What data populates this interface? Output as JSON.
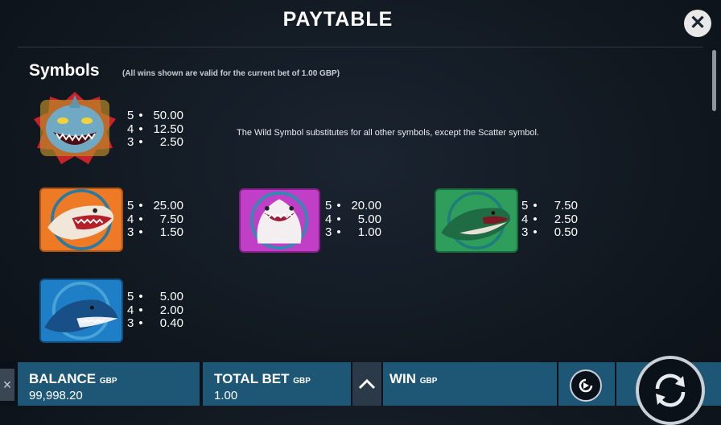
{
  "header": {
    "title": "PAYTABLE",
    "close_icon": "close-icon"
  },
  "symbols": {
    "title": "Symbols",
    "note": "(All wins shown are valid for the current bet of 1.00 GBP)",
    "wild_description": "The Wild Symbol substitutes for all other symbols, except the Scatter symbol.",
    "items": [
      {
        "name": "wild-shark",
        "pays": [
          {
            "count": "5",
            "value": "50.00"
          },
          {
            "count": "4",
            "value": "12.50"
          },
          {
            "count": "3",
            "value": "2.50"
          }
        ]
      },
      {
        "name": "orange-shark",
        "pays": [
          {
            "count": "5",
            "value": "25.00"
          },
          {
            "count": "4",
            "value": "7.50"
          },
          {
            "count": "3",
            "value": "1.50"
          }
        ]
      },
      {
        "name": "pink-shark",
        "pays": [
          {
            "count": "5",
            "value": "20.00"
          },
          {
            "count": "4",
            "value": "5.00"
          },
          {
            "count": "3",
            "value": "1.00"
          }
        ]
      },
      {
        "name": "green-shark",
        "pays": [
          {
            "count": "5",
            "value": "7.50"
          },
          {
            "count": "4",
            "value": "2.50"
          },
          {
            "count": "3",
            "value": "0.50"
          }
        ]
      },
      {
        "name": "blue-shark",
        "pays": [
          {
            "count": "5",
            "value": "5.00"
          },
          {
            "count": "4",
            "value": "2.00"
          },
          {
            "count": "3",
            "value": "0.40"
          }
        ]
      }
    ]
  },
  "bottom_bar": {
    "balance_label": "BALANCE",
    "balance_currency": "GBP",
    "balance_value": "99,998.20",
    "total_bet_label": "TOTAL BET",
    "total_bet_currency": "GBP",
    "total_bet_value": "1.00",
    "win_label": "WIN",
    "win_currency": "GBP",
    "left_close_glyph": "×"
  },
  "colors": {
    "panel_blue": "#1e5676",
    "orange_symbol": "#ef7a25",
    "pink_symbol": "#c03fc6",
    "green_symbol": "#2f9e5c",
    "blue_symbol": "#1f7fc6",
    "wild_red": "#d62a2a"
  }
}
